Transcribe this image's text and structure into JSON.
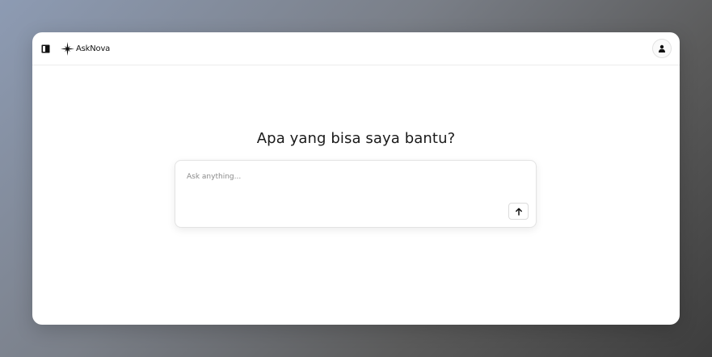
{
  "app": {
    "name": "AskNova"
  },
  "icons": {
    "sidebar_toggle": "sidebar-toggle-icon",
    "brand_logo": "four-point-star-icon",
    "avatar": "user-icon",
    "send": "arrow-up-icon"
  },
  "main": {
    "headline": "Apa yang bisa saya bantu?"
  },
  "composer": {
    "placeholder": "Ask anything...",
    "value": ""
  },
  "colors": {
    "text_primary": "#1a1a1a",
    "border": "#e3e3e3",
    "window_bg": "#ffffff"
  }
}
